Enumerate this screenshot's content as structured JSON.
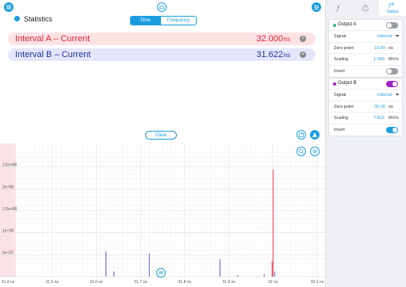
{
  "statistics": {
    "label": "Statistics"
  },
  "mode_tabs": {
    "time": "Time",
    "frequency": "Frequency"
  },
  "measurements": [
    {
      "name": "Interval A – Current",
      "value": "32.000",
      "unit": "ns"
    },
    {
      "name": "Interval B – Current",
      "value": "31.622",
      "unit": "ns"
    }
  ],
  "clear_label": "Clear",
  "side_tabs": {
    "output_label": "Output"
  },
  "output_a": {
    "title": "Output A",
    "enabled": false,
    "signal_label": "Signal",
    "signal_value": "Interval",
    "zero_label": "Zero point",
    "zero_value": "10.60",
    "zero_unit": "ns",
    "scaling_label": "Scaling",
    "scaling_value": "1.000",
    "scaling_unit": "MV/s",
    "invert_label": "Invert",
    "invert": false
  },
  "output_b": {
    "title": "Output B",
    "enabled": true,
    "signal_label": "Signal",
    "signal_value": "Interval",
    "zero_label": "Zero point",
    "zero_value": "32.00",
    "zero_unit": "ns",
    "scaling_label": "Scaling",
    "scaling_value": "7.812",
    "scaling_unit": "MV/s",
    "invert_label": "Invert",
    "invert": true
  },
  "colors": {
    "accent": "#1a9de0",
    "series_a": "#e8394a",
    "series_b": "#5b5fd6",
    "output_b_dot": "#a020c8"
  },
  "chart_data": {
    "type": "bar",
    "x_unit": "ns",
    "xlim": [
      31.4,
      32.1
    ],
    "ylim": [
      0,
      300000000.0
    ],
    "x_ticks": [
      "31.4 ns",
      "31.5 ns",
      "31.6 ns",
      "31.7 ns",
      "31.8 ns",
      "31.9 ns",
      "32 ns",
      "32.1 ns"
    ],
    "y_ticks": [
      {
        "label": "5e+07",
        "value": 50000000.0
      },
      {
        "label": "1e+08",
        "value": 100000000.0
      },
      {
        "label": "1.5e+08",
        "value": 150000000.0
      },
      {
        "label": "2e+08",
        "value": 200000000.0
      },
      {
        "label": "2.5e+08",
        "value": 250000000.0
      }
    ],
    "grid": true,
    "series": [
      {
        "name": "Interval A",
        "color": "#e8394a",
        "points": [
          {
            "x": 32.0,
            "y": 245000000.0
          },
          {
            "x": 31.998,
            "y": 35000000.0
          }
        ]
      },
      {
        "name": "Interval B",
        "color": "#5b5fd6",
        "points": [
          {
            "x": 31.622,
            "y": 58000000.0
          },
          {
            "x": 31.64,
            "y": 12000000.0
          },
          {
            "x": 31.72,
            "y": 53000000.0
          },
          {
            "x": 31.74,
            "y": 3000000.0
          },
          {
            "x": 31.88,
            "y": 40000000.0
          },
          {
            "x": 31.92,
            "y": 4000000.0
          },
          {
            "x": 31.98,
            "y": 6000000.0
          },
          {
            "x": 32.004,
            "y": 12000000.0
          }
        ]
      }
    ]
  }
}
